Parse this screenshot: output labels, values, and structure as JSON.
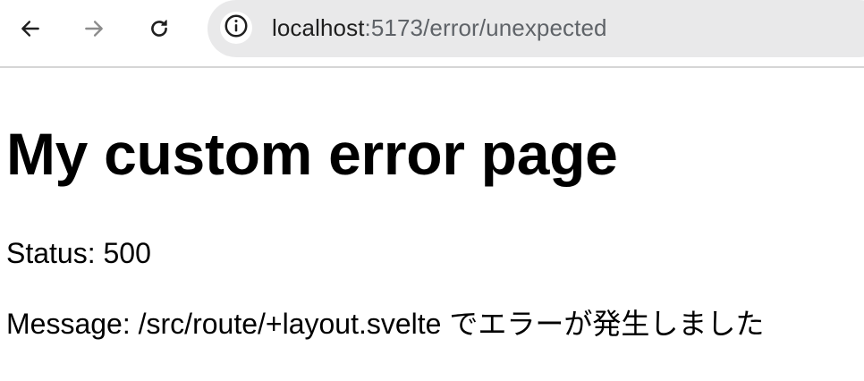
{
  "browser": {
    "url_host": "localhost",
    "url_path": ":5173/error/unexpected",
    "back_icon": "arrow-left-icon",
    "forward_icon": "arrow-right-icon",
    "reload_icon": "reload-icon",
    "site_info_icon": "info-circle-icon"
  },
  "page": {
    "title": "My custom error page",
    "status_text": "Status: 500",
    "message_text": "Message: /src/route/+layout.svelte でエラーが発生しました"
  }
}
